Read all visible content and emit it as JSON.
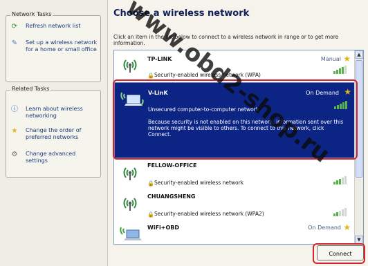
{
  "left_pane": {
    "network_tasks": {
      "title": "Network Tasks",
      "items": [
        {
          "label": "Refresh network list",
          "icon": "refresh-icon"
        },
        {
          "label": "Set up a wireless network for a home or small office",
          "icon": "setup-wizard-icon"
        }
      ]
    },
    "related_tasks": {
      "title": "Related Tasks",
      "items": [
        {
          "label": "Learn about wireless networking",
          "icon": "info-icon"
        },
        {
          "label": "Change the order of preferred networks",
          "icon": "star-icon"
        },
        {
          "label": "Change advanced settings",
          "icon": "settings-icon"
        }
      ]
    }
  },
  "main": {
    "heading": "Choose a wireless network",
    "hint": "Click an item in the list below to connect to a wireless network in range or to get more information.",
    "networks": [
      {
        "name": "TP-LINK",
        "security": "Security-enabled wireless network (WPA)",
        "status": "Manual",
        "signal": 4
      },
      {
        "name": "V-LinK",
        "security": "Unsecured computer-to-computer network",
        "status": "On Demand",
        "signal": 5,
        "selected": true,
        "description": "Because security is not enabled on this network, information sent over this network might be visible to others. To connect to this network, click Connect."
      },
      {
        "name": "FELLOW-OFFICE",
        "security": "Security-enabled wireless network",
        "status": "",
        "signal": 3
      },
      {
        "name": "CHUANGSHENG",
        "security": "Security-enabled wireless network (WPA2)",
        "status": "",
        "signal": 2
      },
      {
        "name": "WiFi+OBD",
        "security": "",
        "status": "On Demand",
        "signal": 0
      }
    ],
    "connect_label": "Connect"
  },
  "watermark": {
    "text": "www.obd2-shop.ru"
  },
  "colors": {
    "selected_bg": "#0c2584",
    "highlight": "#d4242b",
    "signal": "#55b347",
    "link": "#1b3a7a"
  }
}
